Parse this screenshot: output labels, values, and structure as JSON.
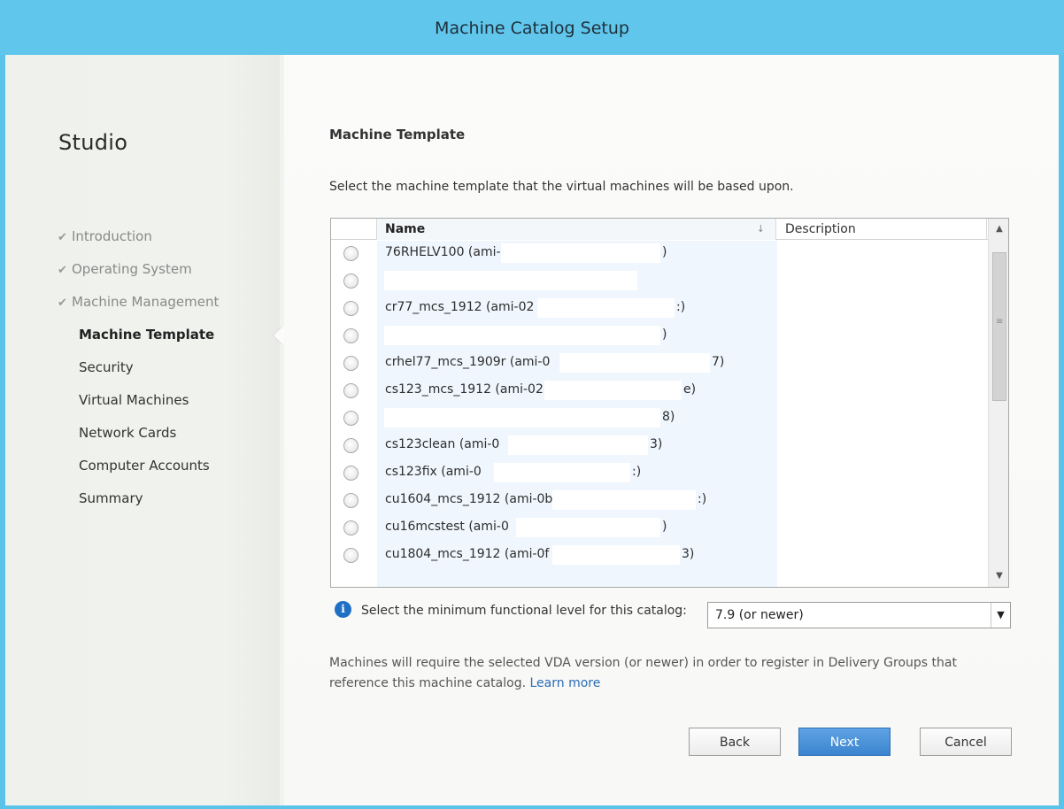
{
  "window": {
    "title": "Machine Catalog Setup"
  },
  "sidebar": {
    "brand": "Studio",
    "steps": [
      {
        "label": "Introduction",
        "state": "done"
      },
      {
        "label": "Operating System",
        "state": "done"
      },
      {
        "label": "Machine Management",
        "state": "done"
      },
      {
        "label": "Machine Template",
        "state": "current"
      },
      {
        "label": "Security",
        "state": "pending"
      },
      {
        "label": "Virtual Machines",
        "state": "pending"
      },
      {
        "label": "Network Cards",
        "state": "pending"
      },
      {
        "label": "Computer Accounts",
        "state": "pending"
      },
      {
        "label": "Summary",
        "state": "pending"
      }
    ]
  },
  "main": {
    "heading": "Machine Template",
    "instruction": "Select the machine template that the virtual machines will be based upon.",
    "table": {
      "columns": {
        "name": "Name",
        "description": "Description"
      },
      "rows": [
        {
          "name": "76RHELV100 (ami-",
          "tail": ")"
        },
        {
          "name": "",
          "tail": ""
        },
        {
          "name": "cr77_mcs_1912 (ami-02",
          "tail": ":)"
        },
        {
          "name": "",
          "tail": ")"
        },
        {
          "name": "crhel77_mcs_1909r (ami-0",
          "tail": "7)"
        },
        {
          "name": "cs123_mcs_1912 (ami-02",
          "tail": "e)"
        },
        {
          "name": "",
          "tail": "8)"
        },
        {
          "name": "cs123clean (ami-0",
          "tail": "3)"
        },
        {
          "name": "cs123fix (ami-0",
          "tail": ":)"
        },
        {
          "name": "cu1604_mcs_1912 (ami-0b",
          "tail": ":)"
        },
        {
          "name": "cu16mcstest (ami-0",
          "tail": ")"
        },
        {
          "name": "cu1804_mcs_1912 (ami-0f",
          "tail": "3)"
        }
      ]
    },
    "functional_level": {
      "label": "Select the minimum functional level for this catalog:",
      "selected": "7.9 (or newer)"
    },
    "help_text": "Machines will require the selected VDA version (or newer) in order to register in Delivery Groups that reference this machine catalog.",
    "learn_more": "Learn more"
  },
  "buttons": {
    "back": "Back",
    "next": "Next",
    "cancel": "Cancel"
  },
  "colors": {
    "titlebar": "#60c6ec",
    "accent_button": "#3b84cf",
    "link": "#2b6cb4"
  }
}
